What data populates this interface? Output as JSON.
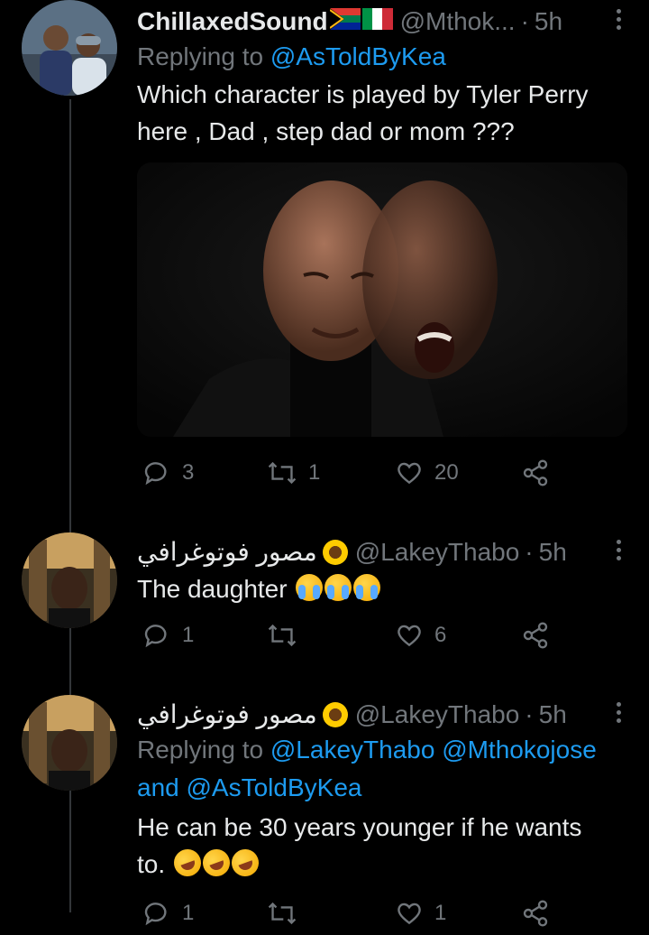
{
  "tweets": [
    {
      "name": "ChillaxedSound",
      "handle": "@Mthok...",
      "time": "5h",
      "reply_prefix": "Replying to",
      "reply_mentions": "@AsToldByKea",
      "text_lines": [
        "Which character is played by Tyler Perry",
        "here , Dad , step dad or mom ???"
      ],
      "stats": {
        "replies": "3",
        "retweets": "1",
        "likes": "20"
      }
    },
    {
      "name": "مصور فوتوغرافي",
      "handle": "@LakeyThabo",
      "time": "5h",
      "text": "The daughter",
      "stats": {
        "replies": "1",
        "retweets": "",
        "likes": "6"
      }
    },
    {
      "name": "مصور فوتوغرافي",
      "handle": "@LakeyThabo",
      "time": "5h",
      "reply_prefix": "Replying to",
      "reply_line1": "@LakeyThabo @Mthokojose",
      "reply_and": "and",
      "reply_line2": "@AsToldByKea",
      "text_lines": [
        "He can be 30 years younger if he wants",
        "to."
      ],
      "stats": {
        "replies": "1",
        "retweets": "",
        "likes": "1"
      }
    }
  ],
  "separator": "·",
  "colors": {
    "background": "#000000",
    "text": "#e7e9ea",
    "secondary": "#71767b",
    "link": "#1d9bf0"
  },
  "icons": [
    "reply-icon",
    "retweet-icon",
    "like-icon",
    "share-icon",
    "more-icon"
  ]
}
